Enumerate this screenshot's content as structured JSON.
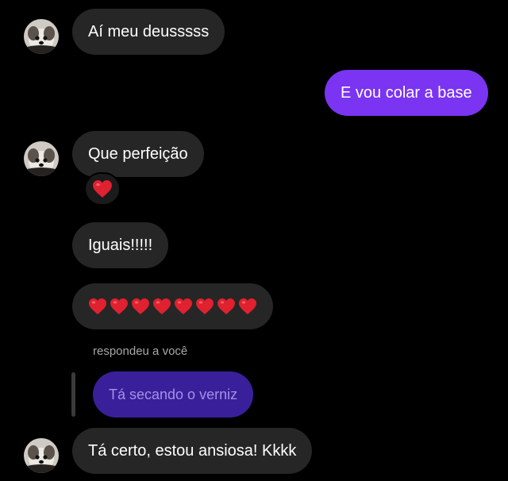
{
  "messages": {
    "m1": {
      "text": "Aí meu deusssss"
    },
    "m2": {
      "text": "E vou colar a base"
    },
    "m3": {
      "text": "Que perfeição",
      "reaction_icon": "red-heart-emoji"
    },
    "m4": {
      "text": "Iguais!!!!!"
    },
    "m5": {
      "hearts_count": 8,
      "icon": "red-heart-emoji"
    },
    "m6": {
      "reply_label": "respondeu a você",
      "quoted_text": "Tá secando o verniz"
    },
    "m7": {
      "text": "Tá certo, estou ansiosa! Kkkk"
    }
  },
  "colors": {
    "background": "#000000",
    "received_bubble": "#262626",
    "sent_bubble": "#7a34f2",
    "quoted_bubble": "#3a1f9a",
    "heart": "#e0212f"
  }
}
